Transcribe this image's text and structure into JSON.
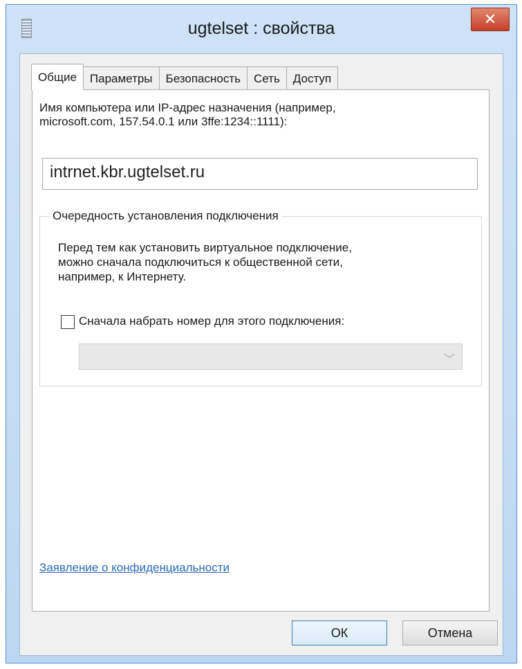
{
  "window": {
    "title": "ugtelset : свойства",
    "close_label": "✕"
  },
  "tabs": [
    {
      "label": "Общие",
      "active": true
    },
    {
      "label": "Параметры",
      "active": false
    },
    {
      "label": "Безопасность",
      "active": false
    },
    {
      "label": "Сеть",
      "active": false
    },
    {
      "label": "Доступ",
      "active": false
    }
  ],
  "general": {
    "host_label_line1": "Имя компьютера или IP-адрес назначения (например,",
    "host_label_line2": "microsoft.com, 157.54.0.1 или 3ffe:1234::1111):",
    "host_value": "intrnet.kbr.ugtelset.ru",
    "group_title": "Очередность установления подключения",
    "group_text_line1": "Перед тем как установить виртуальное подключение,",
    "group_text_line2": "можно сначала подключиться к общественной сети,",
    "group_text_line3": "например, к Интернету.",
    "dial_first_label": "Сначала набрать номер для этого подключения:",
    "dial_first_checked": false,
    "dial_select_value": "",
    "privacy_link": "Заявление о конфиденциальности"
  },
  "buttons": {
    "ok": "ОК",
    "cancel": "Отмена"
  }
}
